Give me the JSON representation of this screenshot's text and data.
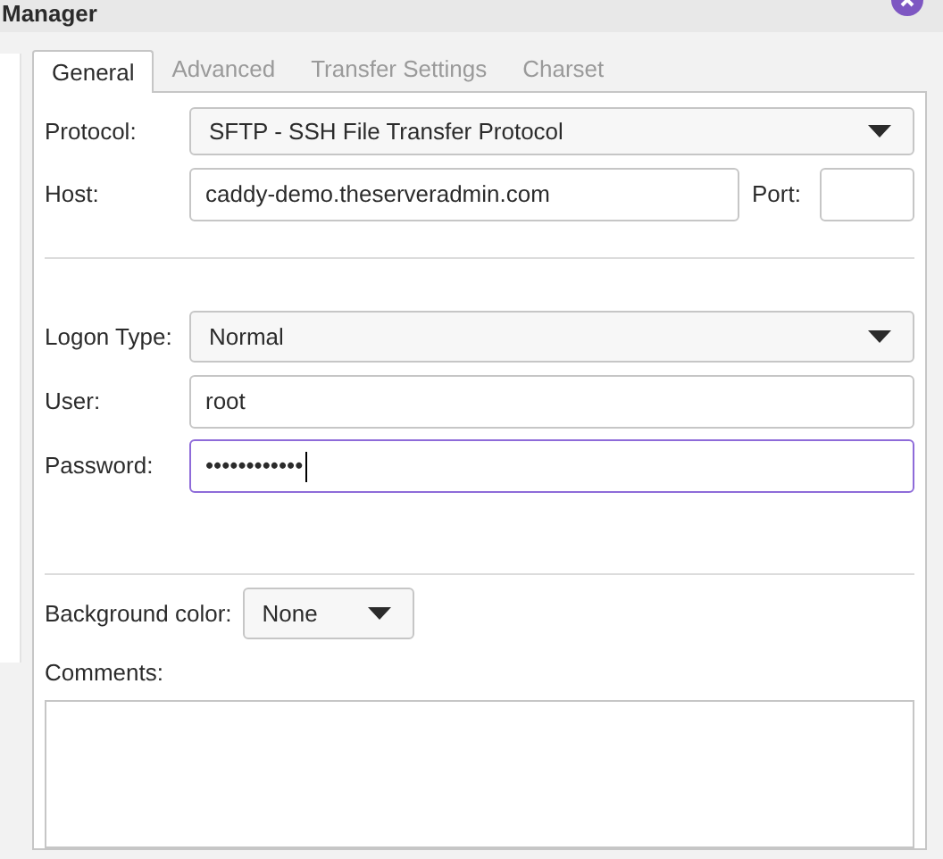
{
  "window": {
    "title": "Manager"
  },
  "tabs": [
    {
      "label": "General",
      "selected": true
    },
    {
      "label": "Advanced",
      "selected": false
    },
    {
      "label": "Transfer Settings",
      "selected": false
    },
    {
      "label": "Charset",
      "selected": false
    }
  ],
  "protocol": {
    "label": "Protocol:",
    "value": "SFTP - SSH File Transfer Protocol"
  },
  "host": {
    "label": "Host:",
    "value": "caddy-demo.theserveradmin.com",
    "port_label": "Port:"
  },
  "logon_type": {
    "label": "Logon Type:",
    "value": "Normal"
  },
  "user": {
    "label": "User:",
    "value": "root",
    "focused": false
  },
  "password": {
    "label": "Password:",
    "value": "••••••••••••",
    "focused": true
  },
  "background_color": {
    "label": "Background color:",
    "value": "None"
  },
  "comments": {
    "label": "Comments:"
  }
}
